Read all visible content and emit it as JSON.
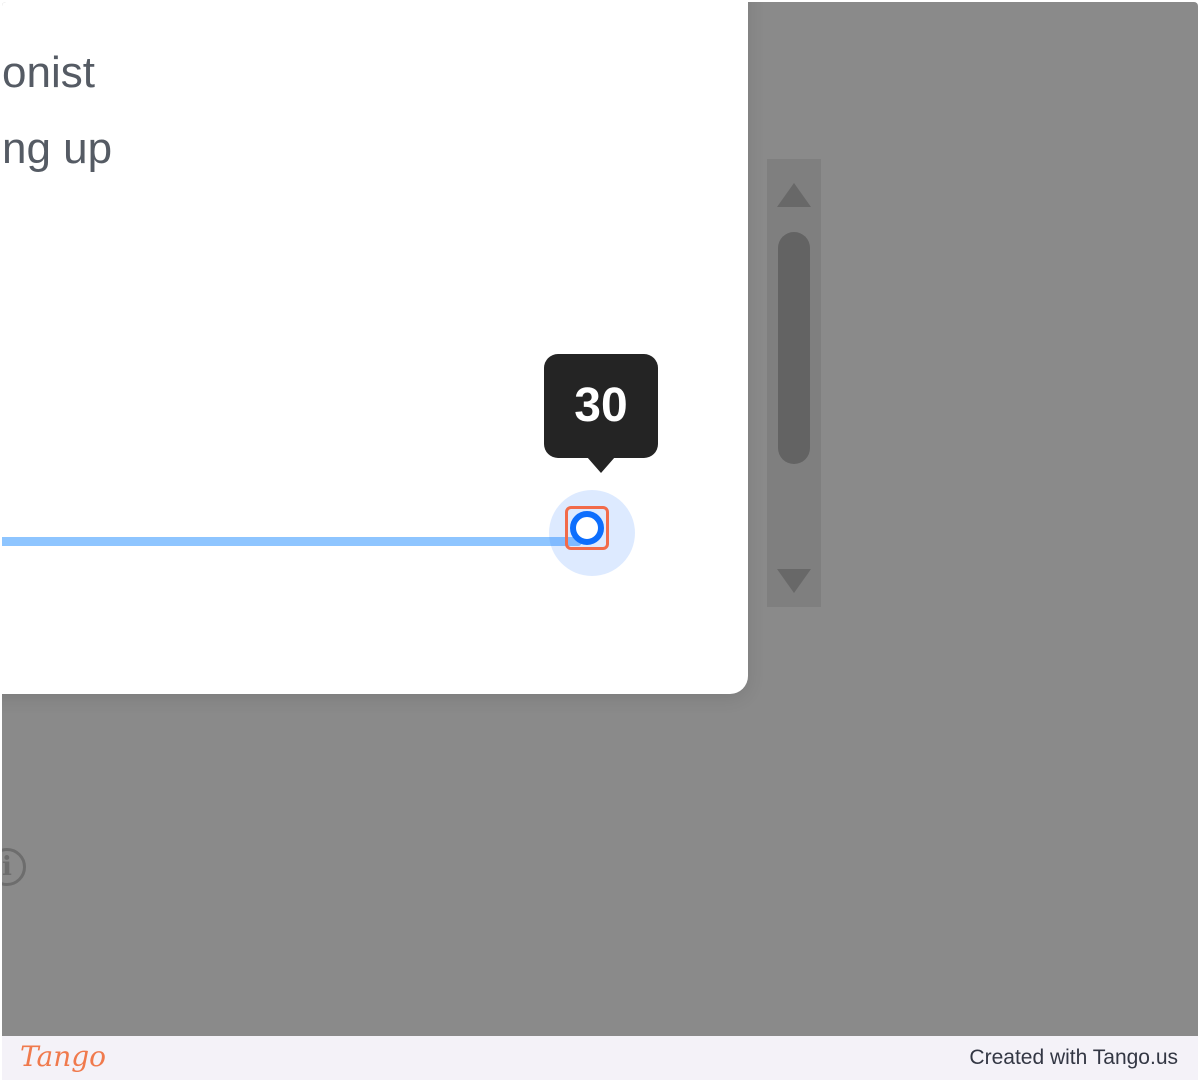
{
  "dialog": {
    "text_line_1": "onist",
    "text_line_2": "ng up"
  },
  "slider": {
    "value_label": "30",
    "accent_color": "#0d6efd",
    "track_color": "#8ec5ff"
  },
  "icons": {
    "info": "info-icon",
    "scroll_up": "triangle-up-icon",
    "scroll_down": "triangle-down-icon"
  },
  "footer": {
    "brand": "Tango",
    "credit": "Created with Tango.us",
    "brand_color": "#f07a4d"
  }
}
